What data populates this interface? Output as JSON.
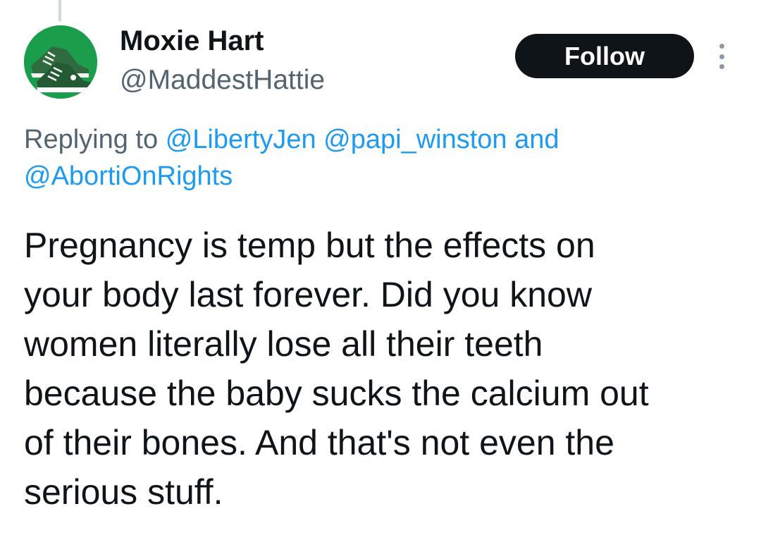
{
  "tweet": {
    "author": {
      "display_name": "Moxie Hart",
      "handle": "@MaddestHattie",
      "avatar": "green-sneakers-avatar"
    },
    "follow_label": "Follow",
    "more_icon": "more-options-icon",
    "reply": {
      "prefix": "Replying to",
      "mention_1": "@LibertyJen",
      "mention_2": "@papi_winston",
      "joiner": "and",
      "mention_3": "@AbortiOnRights"
    },
    "body_lines": [
      "Pregnancy is temp but the effects on",
      "your body last forever. Did you know",
      "women literally lose all their teeth",
      "because the baby sucks the calcium out",
      "of their bones. And that's not even the",
      "serious stuff."
    ]
  },
  "colors": {
    "primary_text": "#0f1419",
    "secondary_text": "#536471",
    "link": "#1d9bf0",
    "follow_bg": "#0f1419",
    "avatar_bg": "#1b9e4b"
  }
}
